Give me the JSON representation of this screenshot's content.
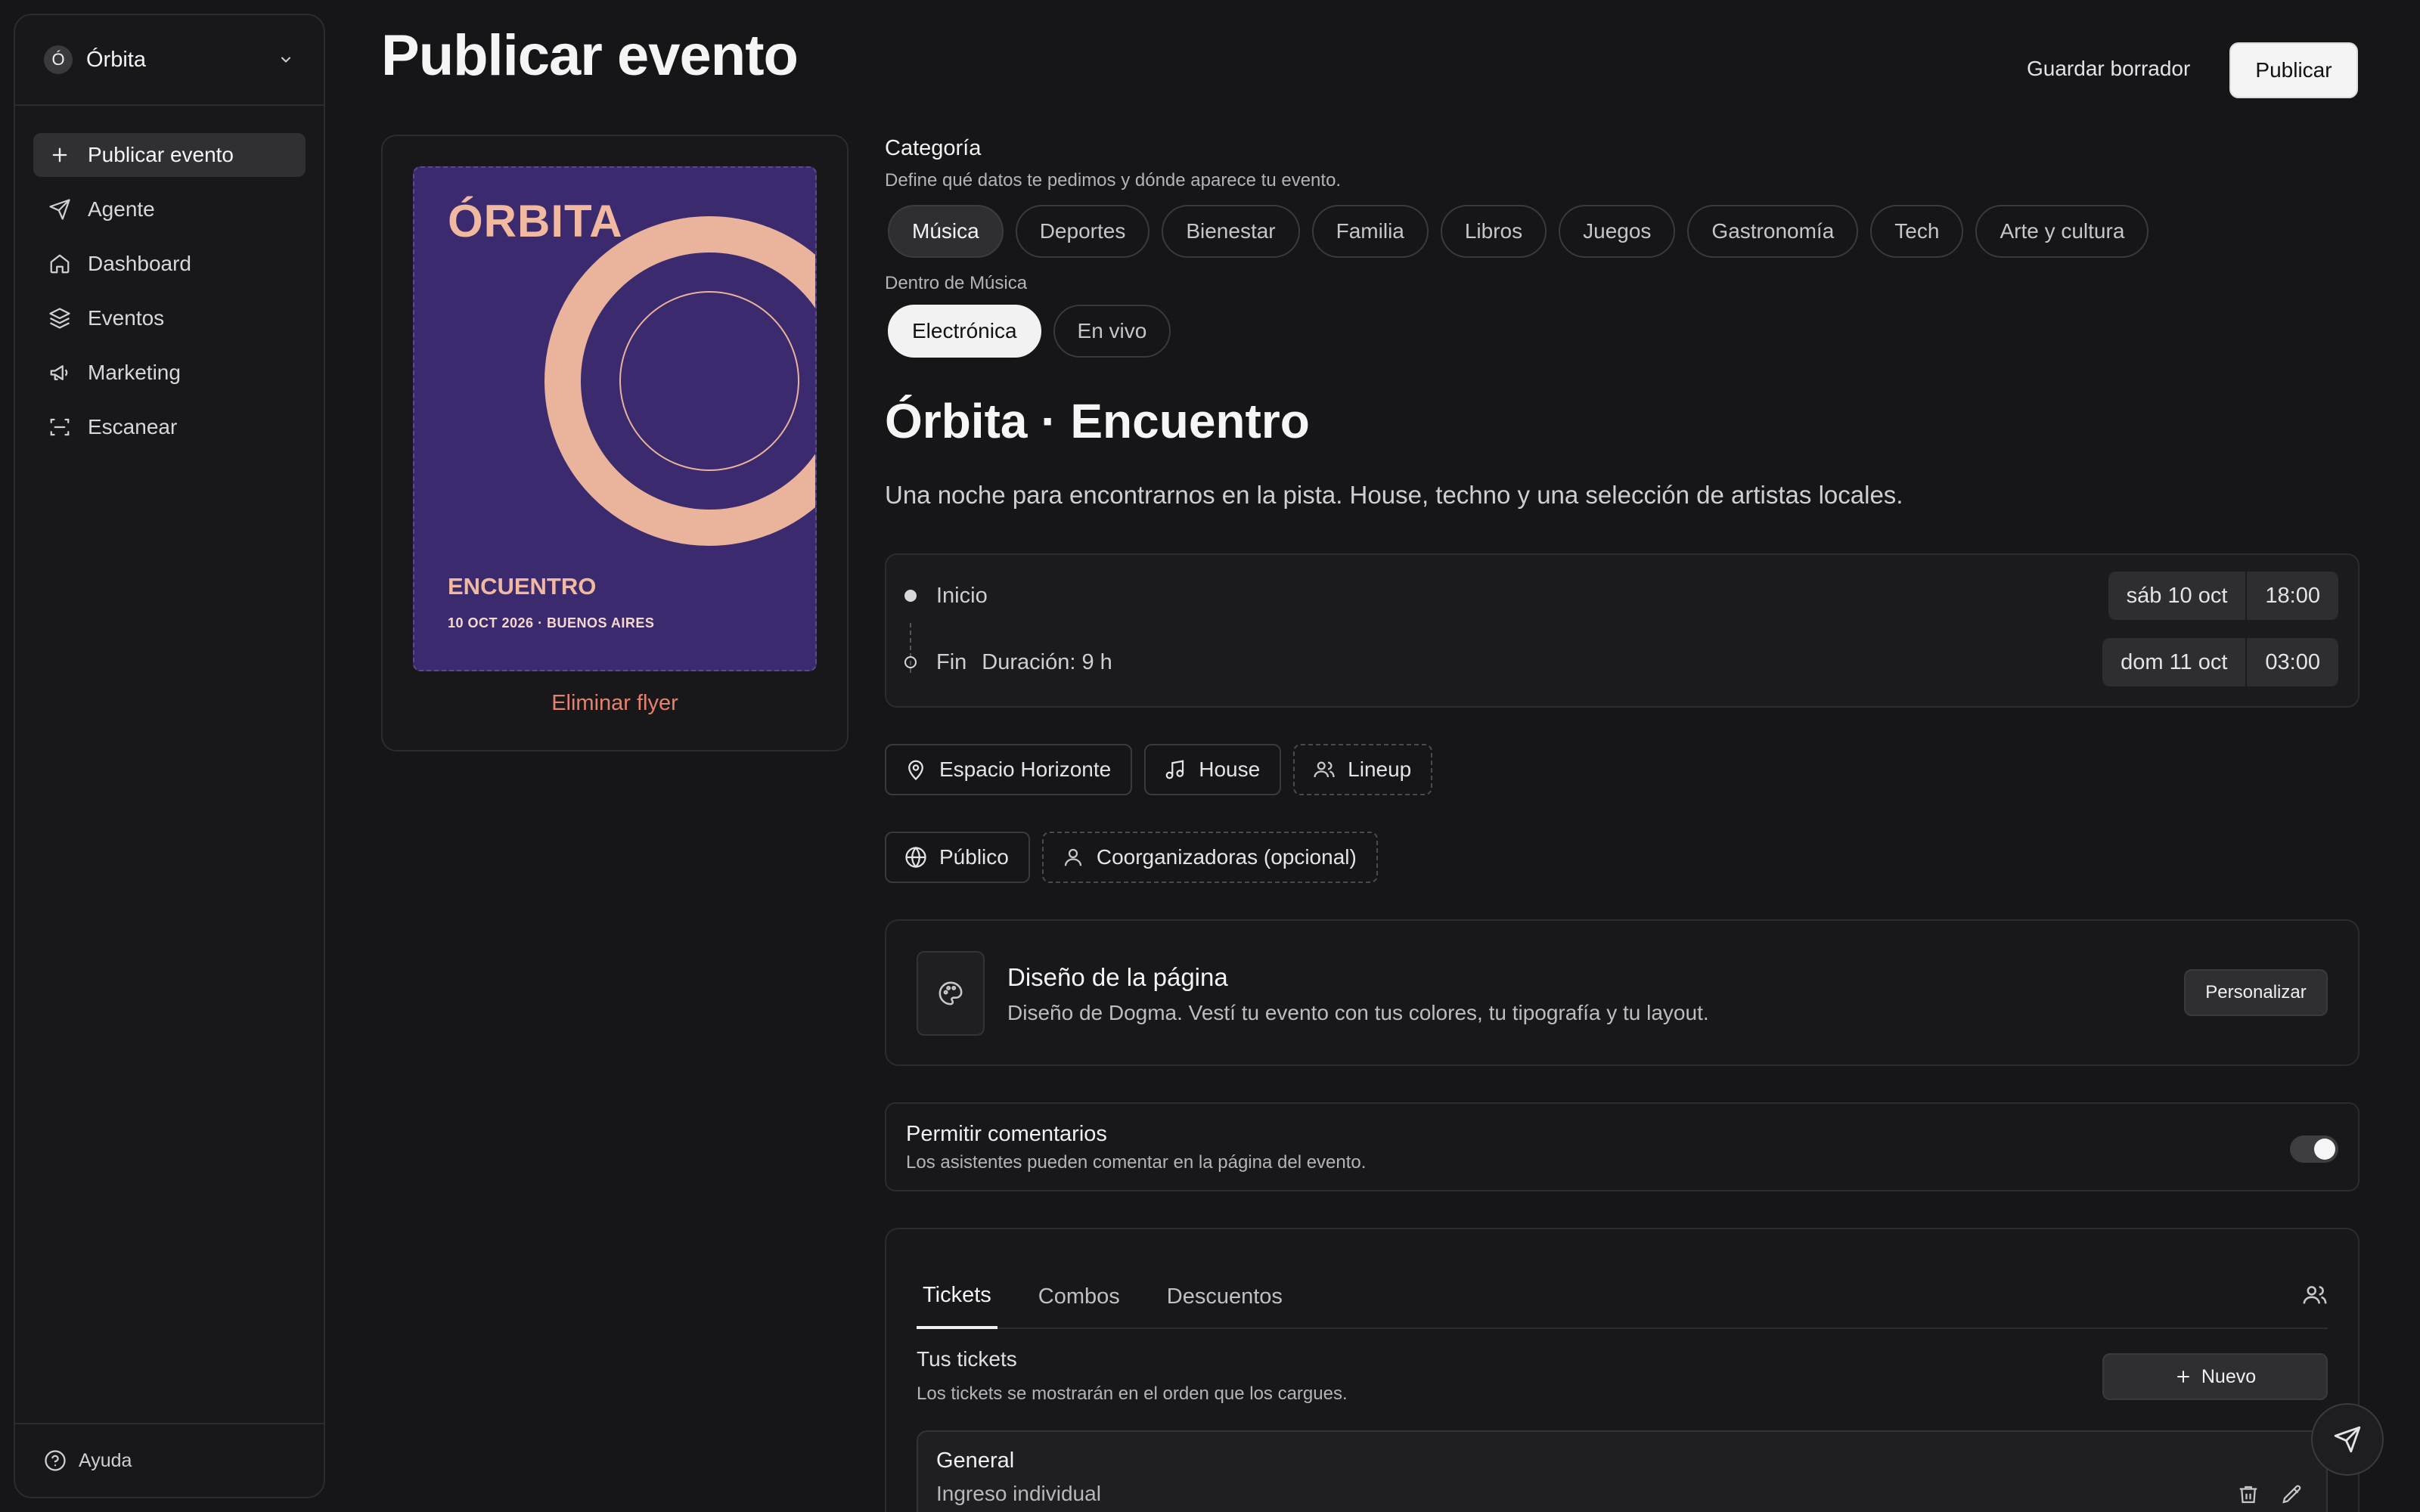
{
  "sidebar": {
    "org": {
      "initial": "Ó",
      "name": "Órbita"
    },
    "items": [
      {
        "label": "Publicar evento",
        "icon": "plus-icon",
        "active": true
      },
      {
        "label": "Agente",
        "icon": "send-icon"
      },
      {
        "label": "Dashboard",
        "icon": "home-icon"
      },
      {
        "label": "Eventos",
        "icon": "layers-icon"
      },
      {
        "label": "Marketing",
        "icon": "megaphone-icon"
      },
      {
        "label": "Escanear",
        "icon": "scan-icon"
      }
    ],
    "help": "Ayuda"
  },
  "header": {
    "title": "Publicar evento",
    "save_draft": "Guardar borrador",
    "publish": "Publicar"
  },
  "flyer": {
    "brand": "ÓRBITA",
    "subtitle": "ENCUENTRO",
    "date_line": "10 OCT 2026 · BUENOS AIRES",
    "remove": "Eliminar flyer",
    "colors": {
      "background": "#3b2a6e",
      "accent": "#f0b9a0"
    }
  },
  "category": {
    "label": "Categoría",
    "hint": "Define qué datos te pedimos y dónde aparece tu evento.",
    "options": [
      "Música",
      "Deportes",
      "Bienestar",
      "Familia",
      "Libros",
      "Juegos",
      "Gastronomía",
      "Tech",
      "Arte y cultura"
    ],
    "selected": "Música",
    "sub_label": "Dentro de Música",
    "sub_options": [
      "Electrónica",
      "En vivo"
    ],
    "sub_selected": "Electrónica"
  },
  "event": {
    "title": "Órbita · Encuentro",
    "description": "Una noche para encontrarnos en la pista. House, techno y una selección de artistas locales."
  },
  "schedule": {
    "start": {
      "label": "Inicio",
      "date": "sáb 10 oct",
      "time": "18:00"
    },
    "end": {
      "label": "Fin",
      "duration": "Duración: 9 h",
      "date": "dom 11 oct",
      "time": "03:00"
    }
  },
  "tags": {
    "venue": "Espacio Horizonte",
    "genre": "House",
    "lineup": "Lineup",
    "visibility": "Público",
    "coorganizers": "Coorganizadoras (opcional)"
  },
  "design": {
    "title": "Diseño de la página",
    "description": "Diseño de Dogma. Vestí tu evento con tus colores, tu tipografía y tu layout.",
    "button": "Personalizar"
  },
  "comments": {
    "title": "Permitir comentarios",
    "description": "Los asistentes pueden comentar en la página del evento.",
    "enabled": true
  },
  "tickets": {
    "tabs": [
      "Tickets",
      "Combos",
      "Descuentos"
    ],
    "active_tab": "Tickets",
    "title": "Tus tickets",
    "hint": "Los tickets se mostrarán en el orden que los cargues.",
    "new_button": "Nuevo",
    "items": [
      {
        "name": "General",
        "type": "Ingreso individual"
      }
    ]
  }
}
